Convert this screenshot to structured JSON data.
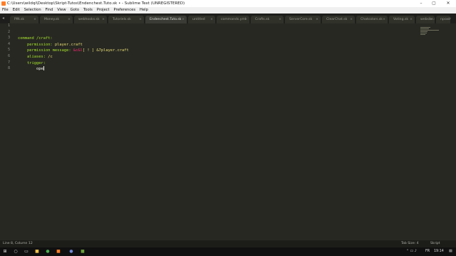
{
  "window": {
    "title": "C:\\Users\\wildqi\\Desktop\\Skript-Tutos\\Endenchest.Tuto.sk • - Sublime Text (UNREGISTERED)",
    "minimize_glyph": "–",
    "maximize_glyph": "▢",
    "close_glyph": "✕"
  },
  "menu": [
    "File",
    "Edit",
    "Selection",
    "Find",
    "View",
    "Goto",
    "Tools",
    "Project",
    "Preferences",
    "Help"
  ],
  "tabs": [
    {
      "label": "PIN.sk",
      "active": false
    },
    {
      "label": "Money.sk",
      "active": false
    },
    {
      "label": "webhooks.sk",
      "active": false
    },
    {
      "label": "Tutoriels.sk",
      "active": false
    },
    {
      "label": "Endenchest.Tuto.sk",
      "active": true
    },
    {
      "label": "untitled",
      "active": false
    },
    {
      "label": "commands.yml",
      "active": false
    },
    {
      "label": "Crafts.sk",
      "active": false
    },
    {
      "label": "ServerCore.sk",
      "active": false
    },
    {
      "label": "ClearChat.sk",
      "active": false
    },
    {
      "label": "Chatcolors.sk",
      "active": false
    },
    {
      "label": "Voting.sk",
      "active": false
    },
    {
      "label": "website.sk",
      "active": false
    },
    {
      "label": "npc.sk",
      "active": false
    }
  ],
  "tab_close_glyph": "×",
  "editor": {
    "line_numbers": [
      "1",
      "2",
      "3",
      "4",
      "5",
      "6",
      "7",
      "8"
    ],
    "lines": [
      {
        "parts": []
      },
      {
        "parts": []
      },
      {
        "parts": [
          {
            "t": "command /craft:",
            "c": "kw"
          }
        ]
      },
      {
        "parts": [
          {
            "t": "    permission: ",
            "c": "kw"
          },
          {
            "t": "player.craft",
            "c": "pr"
          }
        ]
      },
      {
        "parts": [
          {
            "t": "    permission message: ",
            "c": "kw"
          },
          {
            "t": "&c&l",
            "c": "red"
          },
          {
            "t": "[ ! ] ",
            "c": "pr"
          },
          {
            "t": "&7player.craft",
            "c": "pr"
          }
        ]
      },
      {
        "parts": [
          {
            "t": "    aliases: ",
            "c": "kw"
          },
          {
            "t": "/c",
            "c": "pr"
          }
        ]
      },
      {
        "parts": [
          {
            "t": "    trigger:",
            "c": "kw"
          }
        ]
      },
      {
        "parts": [
          {
            "t": "        ope",
            "c": "pl"
          }
        ],
        "cursor": true
      }
    ]
  },
  "status": {
    "position": "Line 8, Column 12",
    "tab_size": "Tab Size: 4",
    "syntax": "Skript"
  },
  "taskbar": {
    "apps": [
      "start-button",
      "search-button",
      "task-view-button",
      "file-explorer-icon",
      "chrome-icon",
      "sublime-text-icon",
      "discord-icon",
      "minecraft-icon"
    ],
    "language": "FR",
    "time": "19:14"
  }
}
